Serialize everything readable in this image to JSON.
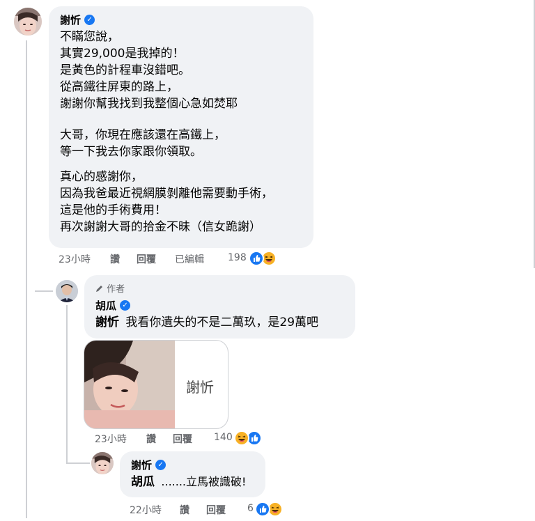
{
  "comment1": {
    "author": "謝忻",
    "paragraph1": [
      "不瞞您說，",
      "其實29,000是我掉的！",
      "是黃色的計程車沒錯吧。",
      "從高鐵往屏東的路上，",
      "謝謝你幫我找到我整個心急如焚耶"
    ],
    "paragraph2": [
      "大哥，你現在應該還在高鐵上，",
      "等一下我去你家跟你領取。"
    ],
    "paragraph3": [
      "真心的感謝你，",
      "因為我爸最近視網膜剝離他需要動手術，",
      "這是他的手術費用！",
      "再次謝謝大哥的拾金不昧（信女跪謝）"
    ],
    "time": "23小時",
    "like_label": "讚",
    "reply_label": "回覆",
    "edited_label": "已編輯",
    "reaction_count": "198"
  },
  "reply1": {
    "author_badge": "作者",
    "author": "胡瓜",
    "mention": "謝忻",
    "text": "我看你遺失的不是二萬玖，是29萬吧",
    "sticker_caption": "謝忻",
    "time": "23小時",
    "like_label": "讚",
    "reply_label": "回覆",
    "reaction_count": "140"
  },
  "reply2": {
    "author": "謝忻",
    "mention": "胡瓜",
    "text": ".......立馬被識破!",
    "time": "22小時",
    "like_label": "讚",
    "reply_label": "回覆",
    "reaction_count": "6"
  },
  "colors": {
    "bubble": "#f0f2f5",
    "meta": "#65676b",
    "verified": "#1877f2",
    "like": "#1877f2",
    "haha": "#f7b125"
  }
}
